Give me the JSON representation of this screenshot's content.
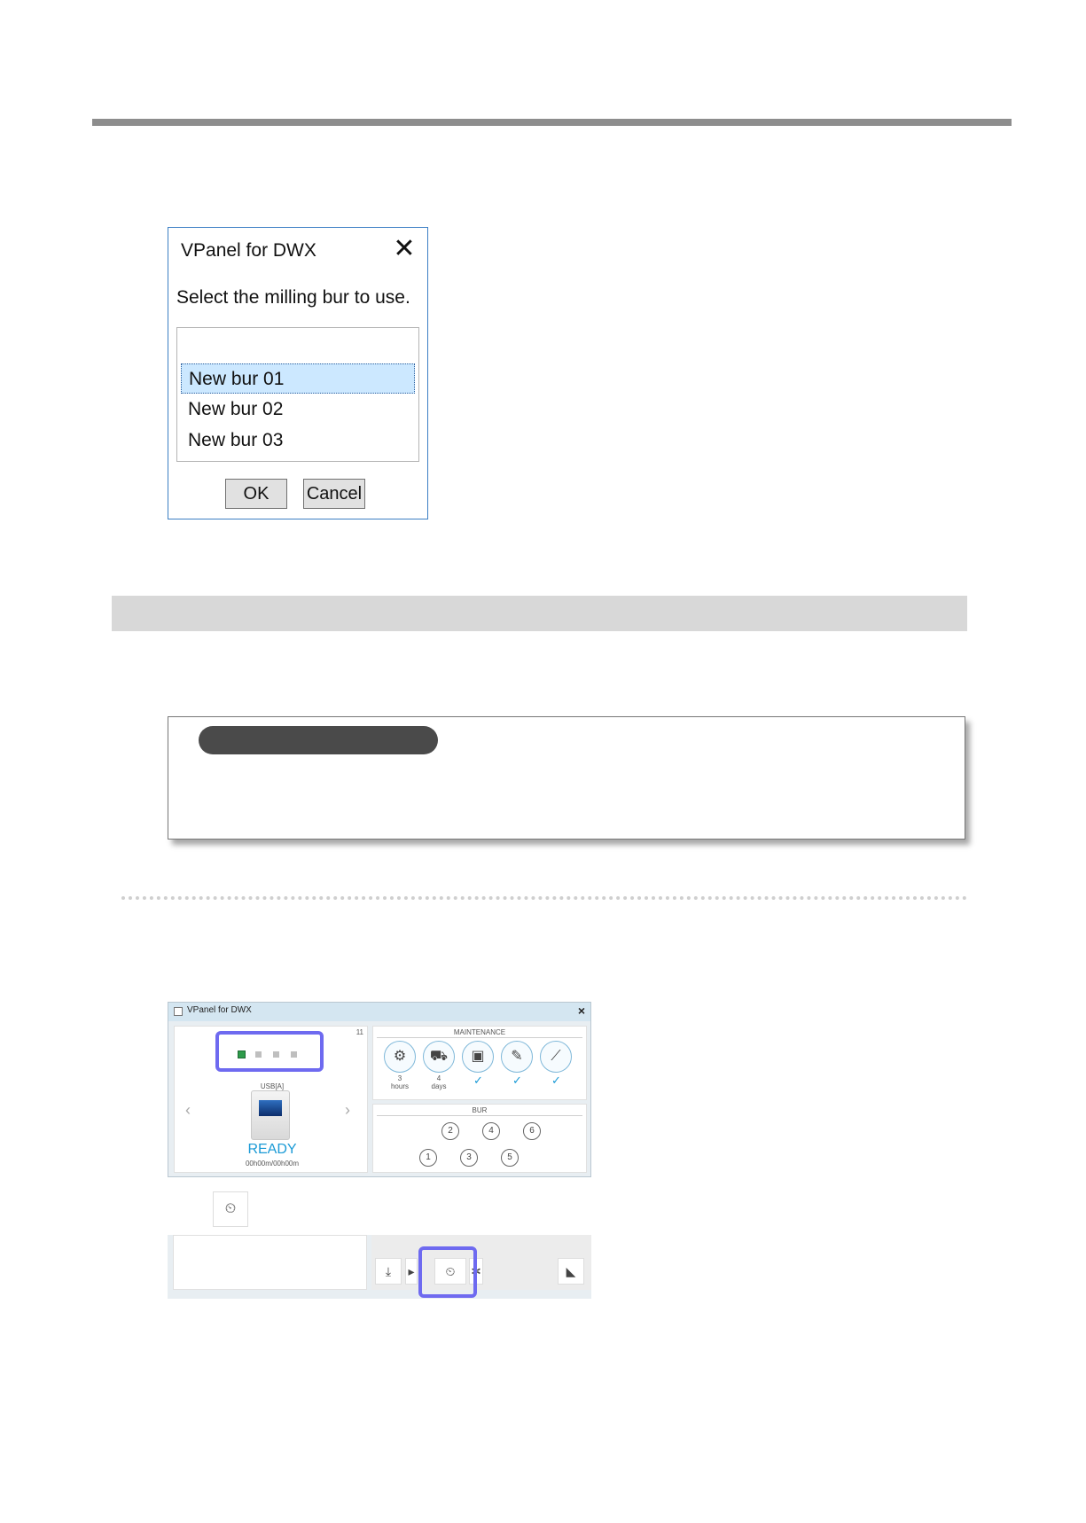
{
  "dialog": {
    "title": "VPanel for DWX",
    "close_glyph": "✕",
    "prompt": "Select the milling bur to use.",
    "bur_list": [
      "New bur 01",
      "New bur 02",
      "New bur 03"
    ],
    "selected_index": 0,
    "ok_label": "OK",
    "cancel_label": "Cancel"
  },
  "vpanel": {
    "title": "VPanel for DWX",
    "close_glyph": "×",
    "corner_label": "11",
    "connection": "USB[A]",
    "status": "READY",
    "elapsed": "00h00m/00h00m",
    "maintenance": {
      "heading": "MAINTENANCE",
      "items": [
        {
          "icon": "spindle-maintenance-icon",
          "value": "3",
          "unit": "hours"
        },
        {
          "icon": "machine-cleaning-icon",
          "value": "4",
          "unit": "days"
        },
        {
          "icon": "dust-collector-icon",
          "value": "✓",
          "unit": ""
        },
        {
          "icon": "collet-cleaning-icon",
          "value": "✓",
          "unit": ""
        },
        {
          "icon": "bur-check-icon",
          "value": "✓",
          "unit": ""
        }
      ]
    },
    "bur": {
      "heading": "BUR",
      "top_row": [
        "2",
        "4",
        "6"
      ],
      "bottom_row": [
        "1",
        "3",
        "5"
      ]
    }
  },
  "colors": {
    "highlight": "#6e6af0",
    "ready": "#1a9ad6",
    "accent_green": "#2e9b4a"
  }
}
